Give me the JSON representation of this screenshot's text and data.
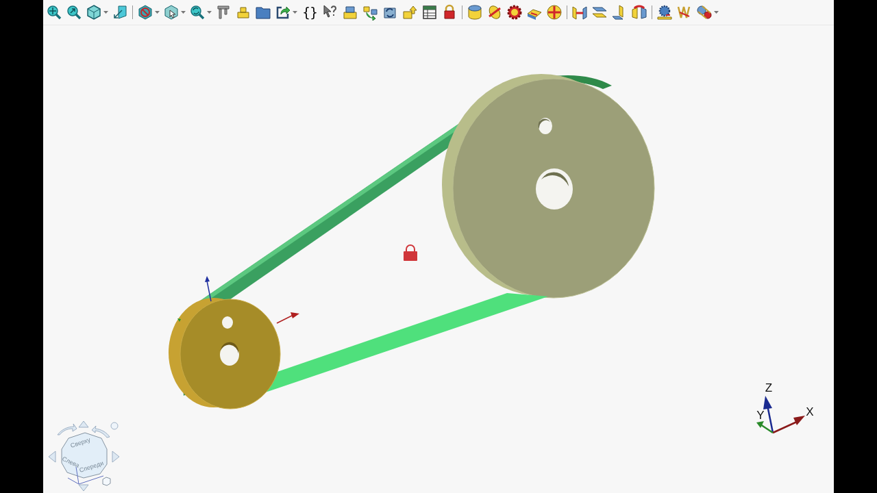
{
  "toolbar": {
    "groups": [
      [
        {
          "kind": "zoom-all",
          "menu": false
        },
        {
          "kind": "zoom-window",
          "menu": false
        },
        {
          "kind": "view-orient",
          "menu": true
        },
        {
          "kind": "normal-to",
          "menu": false
        }
      ],
      [
        {
          "kind": "hide",
          "menu": true
        },
        {
          "kind": "select-box",
          "menu": true
        },
        {
          "kind": "zoom-refresh",
          "menu": true
        },
        {
          "kind": "caliper",
          "menu": false
        },
        {
          "kind": "blocks",
          "menu": false
        },
        {
          "kind": "folder",
          "menu": false
        },
        {
          "kind": "export",
          "menu": true
        },
        {
          "kind": "text",
          "label": "{}"
        },
        {
          "kind": "help",
          "menu": false
        },
        {
          "kind": "block-stack",
          "menu": false
        },
        {
          "kind": "block-move",
          "menu": false
        },
        {
          "kind": "refresh",
          "menu": false
        },
        {
          "kind": "block-arrow",
          "menu": false
        },
        {
          "kind": "table",
          "menu": false
        },
        {
          "kind": "lock",
          "menu": false
        }
      ],
      [
        {
          "kind": "cylinder",
          "menu": false
        },
        {
          "kind": "rotate-disk",
          "menu": false
        },
        {
          "kind": "gear-disk",
          "menu": false
        },
        {
          "kind": "block-slide",
          "menu": false
        },
        {
          "kind": "cross-ball",
          "menu": false
        }
      ],
      [
        {
          "kind": "mirror",
          "menu": false
        },
        {
          "kind": "planes",
          "menu": false
        },
        {
          "kind": "angle-planes",
          "menu": false
        },
        {
          "kind": "flip",
          "menu": false
        }
      ],
      [
        {
          "kind": "gear-rack",
          "menu": false
        },
        {
          "kind": "spring",
          "menu": false
        },
        {
          "kind": "belt",
          "menu": true
        }
      ]
    ]
  },
  "view_cube": {
    "labels": [
      "Сверху",
      "Слева",
      "Спереди"
    ]
  },
  "axis_triad": {
    "labels": [
      "Z",
      "Y",
      "X"
    ]
  }
}
